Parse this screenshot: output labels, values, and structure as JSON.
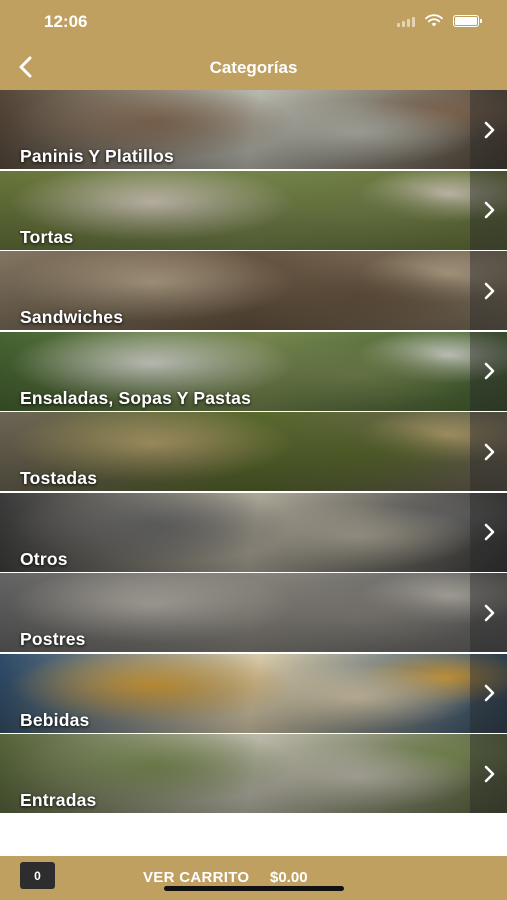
{
  "status_bar": {
    "time": "12:06"
  },
  "nav": {
    "title": "Categorías",
    "back_icon": "chevron-left-icon"
  },
  "categories": [
    {
      "label": "Paninis Y Platillos",
      "colors": [
        "#5a4a3a",
        "#8c7058",
        "#c2c3b8"
      ]
    },
    {
      "label": "Tortas",
      "colors": [
        "#6e7d3f",
        "#d8cfc0",
        "#7a8a4e"
      ]
    },
    {
      "label": "Sandwiches",
      "colors": [
        "#8a7c66",
        "#b9a88d",
        "#6e5a45"
      ]
    },
    {
      "label": "Ensaladas, Sopas Y Pastas",
      "colors": [
        "#4a6a35",
        "#d9dcd2",
        "#7d8f54"
      ]
    },
    {
      "label": "Tostadas",
      "colors": [
        "#736a5a",
        "#b7a36e",
        "#5d6f2e"
      ]
    },
    {
      "label": "Otros",
      "colors": [
        "#3e3e3e",
        "#6b6b6b",
        "#b6b0a0"
      ]
    },
    {
      "label": "Postres",
      "colors": [
        "#6a6a6a",
        "#b8b3aa",
        "#8e8a82"
      ]
    },
    {
      "label": "Bebidas",
      "colors": [
        "#2f4f6f",
        "#d8a23c",
        "#e4d6b3"
      ]
    },
    {
      "label": "Entradas",
      "colors": [
        "#5b6a3c",
        "#7d8f56",
        "#c7c4b4"
      ]
    }
  ],
  "chevron_icon": "chevron-right-icon",
  "cart": {
    "count": "0",
    "label": "VER CARRITO",
    "total": "$0.00"
  },
  "colors": {
    "brand": "#c0a060",
    "cart_badge": "#2d2d2d"
  }
}
